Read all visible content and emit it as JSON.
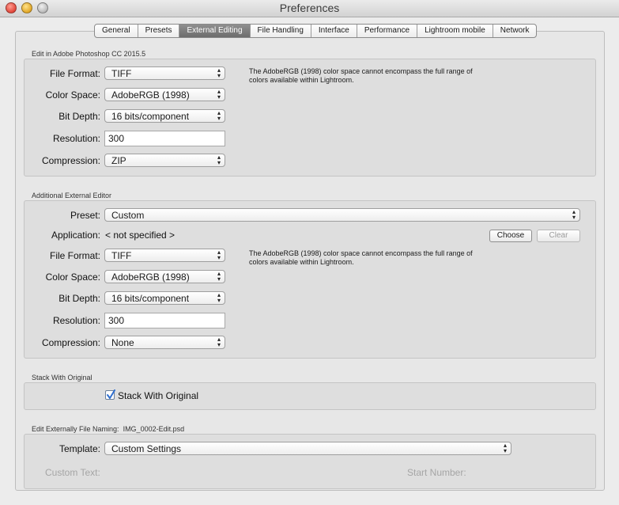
{
  "window": {
    "title": "Preferences"
  },
  "tabs": [
    {
      "label": "General"
    },
    {
      "label": "Presets"
    },
    {
      "label": "External Editing"
    },
    {
      "label": "File Handling"
    },
    {
      "label": "Interface"
    },
    {
      "label": "Performance"
    },
    {
      "label": "Lightroom mobile"
    },
    {
      "label": "Network"
    }
  ],
  "active_tab": "External Editing",
  "photoshop": {
    "section_title": "Edit in Adobe Photoshop CC 2015.5",
    "file_format_label": "File Format:",
    "file_format": "TIFF",
    "color_space_label": "Color Space:",
    "color_space": "AdobeRGB (1998)",
    "bit_depth_label": "Bit Depth:",
    "bit_depth": "16 bits/component",
    "resolution_label": "Resolution:",
    "resolution": "300",
    "compression_label": "Compression:",
    "compression": "ZIP",
    "note": "The AdobeRGB (1998) color space cannot encompass the full range of colors available within Lightroom."
  },
  "additional": {
    "section_title": "Additional External Editor",
    "preset_label": "Preset:",
    "preset": "Custom",
    "application_label": "Application:",
    "application": "< not specified >",
    "choose_label": "Choose",
    "clear_label": "Clear",
    "file_format_label": "File Format:",
    "file_format": "TIFF",
    "color_space_label": "Color Space:",
    "color_space": "AdobeRGB (1998)",
    "bit_depth_label": "Bit Depth:",
    "bit_depth": "16 bits/component",
    "resolution_label": "Resolution:",
    "resolution": "300",
    "compression_label": "Compression:",
    "compression": "None",
    "note": "The AdobeRGB (1998) color space cannot encompass the full range of colors available within Lightroom."
  },
  "stack": {
    "section_title": "Stack With Original",
    "checkbox_label": "Stack With Original",
    "checked": true
  },
  "naming": {
    "section_title": "Edit Externally File Naming:",
    "example": "IMG_0002-Edit.psd",
    "template_label": "Template:",
    "template": "Custom Settings",
    "custom_text_label": "Custom Text:",
    "start_number_label": "Start Number:"
  },
  "colors": {
    "active_tab_bg": "#7d7d7d",
    "checkbox_blue": "#2f6fd0"
  }
}
